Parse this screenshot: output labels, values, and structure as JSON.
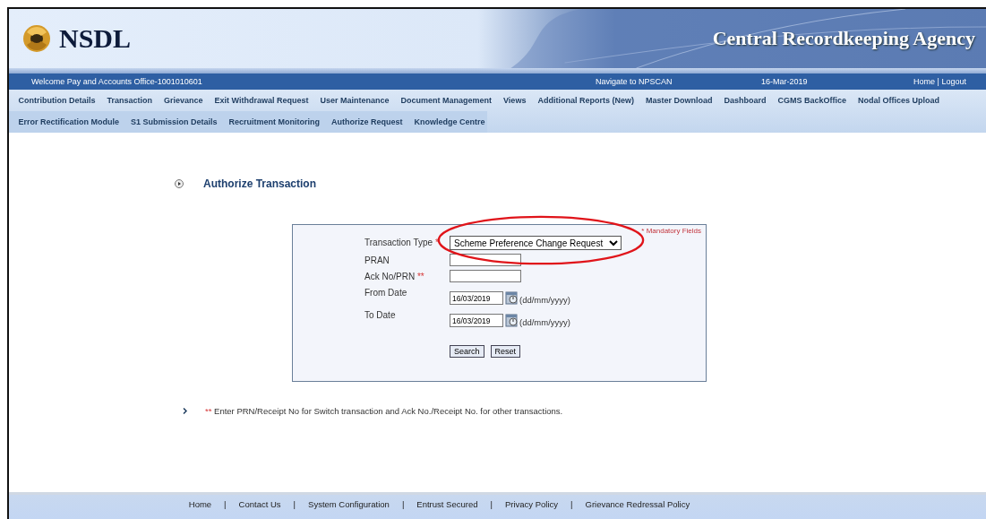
{
  "header": {
    "logo_text": "NSDL",
    "agency_title": "Central Recordkeeping Agency"
  },
  "info_bar": {
    "welcome": "Welcome Pay and Accounts Office-1001010601",
    "navigate": "Navigate to NPSCAN",
    "date": "16-Mar-2019",
    "links": [
      "Home",
      "Logout"
    ],
    "separator": "|"
  },
  "menu_rows": [
    [
      "Contribution Details",
      "Transaction",
      "Grievance",
      "Exit Withdrawal Request",
      "User Maintenance",
      "Document Management",
      "Views",
      "Additional Reports (New)",
      "Master Download",
      "Dashboard",
      "CGMS BackOffice",
      "Nodal Offices Upload"
    ],
    [
      "Error Rectification Module",
      "S1 Submission Details",
      "Recruitment Monitoring",
      "Authorize Request",
      "Knowledge Centre"
    ]
  ],
  "page_title": "Authorize Transaction",
  "form": {
    "mandatory_note": "* Mandatory Fields",
    "fields": [
      {
        "label": "Transaction Type",
        "marker": "*",
        "kind": "select",
        "value": "Scheme Preference Change Request"
      },
      {
        "label": "PRAN",
        "kind": "text"
      },
      {
        "label": "Ack No/PRN",
        "marker": "**",
        "kind": "text"
      },
      {
        "label": "From Date",
        "kind": "date",
        "value": "16/03/2019",
        "hint": "(dd/mm/yyyy)"
      },
      {
        "label": "To Date",
        "kind": "date",
        "value": "16/03/2019",
        "hint": "(dd/mm/yyyy)"
      }
    ],
    "buttons": [
      "Search",
      "Reset"
    ]
  },
  "note": {
    "marker": "**",
    "text": "Enter PRN/Receipt No for Switch transaction and Ack No./Receipt No. for other transactions."
  },
  "footer": {
    "links": [
      "Home",
      "Contact Us",
      "System Configuration",
      "Entrust Secured",
      "Privacy Policy",
      "Grievance Redressal Policy"
    ],
    "separator": "|"
  }
}
